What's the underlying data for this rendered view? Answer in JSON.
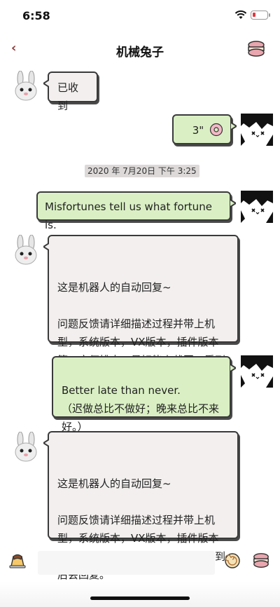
{
  "status": {
    "time": "6:58"
  },
  "nav": {
    "back": "‹",
    "title": "机械兔子",
    "right_icon": "macaron-icon"
  },
  "messages": [
    {
      "side": "left",
      "sender": "bot",
      "text": "已收到"
    },
    {
      "side": "right",
      "sender": "me",
      "text": "3\"",
      "emoji": "donut"
    },
    {
      "side": "right",
      "sender": "me",
      "text": "Misfortunes tell us what fortune is."
    },
    {
      "side": "left",
      "sender": "bot",
      "text": "这是机器人的自动回复~\n\n问题反馈请详细描述过程并带上机型，系统版本，VX版本，插件版本等，方便排查，最好能上截图，看到后会回复。"
    },
    {
      "side": "right",
      "sender": "me",
      "text": "Better late than never.\n（迟做总比不做好；晚来总比不来好。）"
    },
    {
      "side": "left",
      "sender": "bot",
      "text": "这是机器人的自动回复~\n\n问题反馈请详细描述过程并带上机型，系统版本，VX版本，插件版本等，方便排查，最好能上截图，看到后会回复。"
    }
  ],
  "timestamp": "2020 年 7月20日 下午 3:25",
  "input": {
    "placeholder": "",
    "left_icon": "pudding-icon",
    "emoji_icon": "cake-roll-icon",
    "more_icon": "macaron-icon"
  },
  "colors": {
    "bot_bubble": "#f2efee",
    "me_bubble": "#daf0c4",
    "border": "#3a3a3a",
    "accent": "#8b3a3a"
  }
}
